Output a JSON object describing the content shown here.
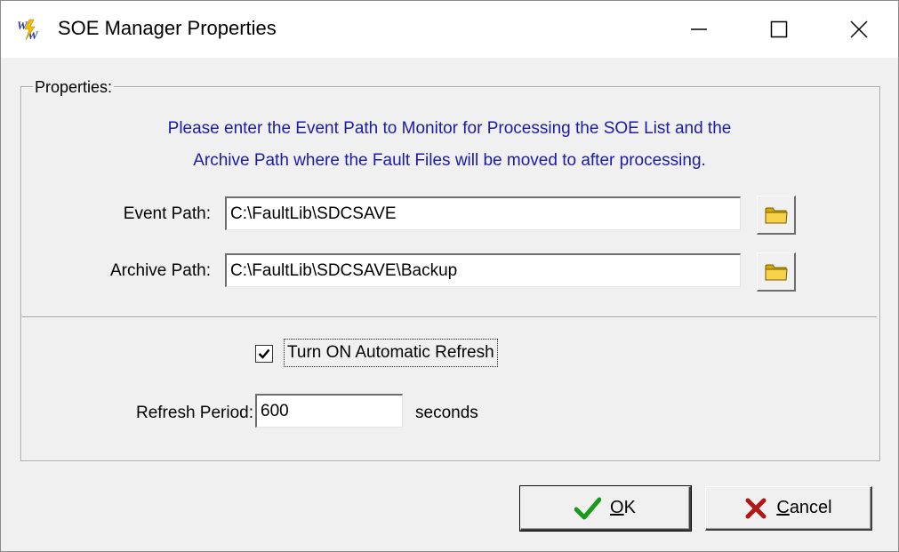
{
  "window": {
    "title": "SOE Manager Properties",
    "controls": {
      "minimize_icon": "minimize-icon",
      "maximize_icon": "maximize-icon",
      "close_icon": "close-icon"
    }
  },
  "properties": {
    "group_label": "Properties:",
    "instructions_line1": "Please enter the Event Path to Monitor for Processing the SOE List and the",
    "instructions_line2": "Archive Path where the Fault Files will be moved to after processing.",
    "event_path": {
      "label": "Event Path:",
      "value": "C:\\FaultLib\\SDCSAVE"
    },
    "archive_path": {
      "label": "Archive Path:",
      "value": "C:\\FaultLib\\SDCSAVE\\Backup"
    },
    "auto_refresh": {
      "label": "Turn ON Automatic Refresh",
      "checked": true
    },
    "refresh_period": {
      "label": "Refresh Period:",
      "value": "600",
      "suffix": "seconds"
    }
  },
  "buttons": {
    "ok": {
      "accel": "O",
      "rest": "K"
    },
    "cancel": {
      "accel": "C",
      "rest": "ancel"
    }
  },
  "colors": {
    "instruction_text": "#1c1ca0",
    "ok_check": "#1a9a1a",
    "cancel_x": "#b01818",
    "folder": "#e8c020"
  }
}
